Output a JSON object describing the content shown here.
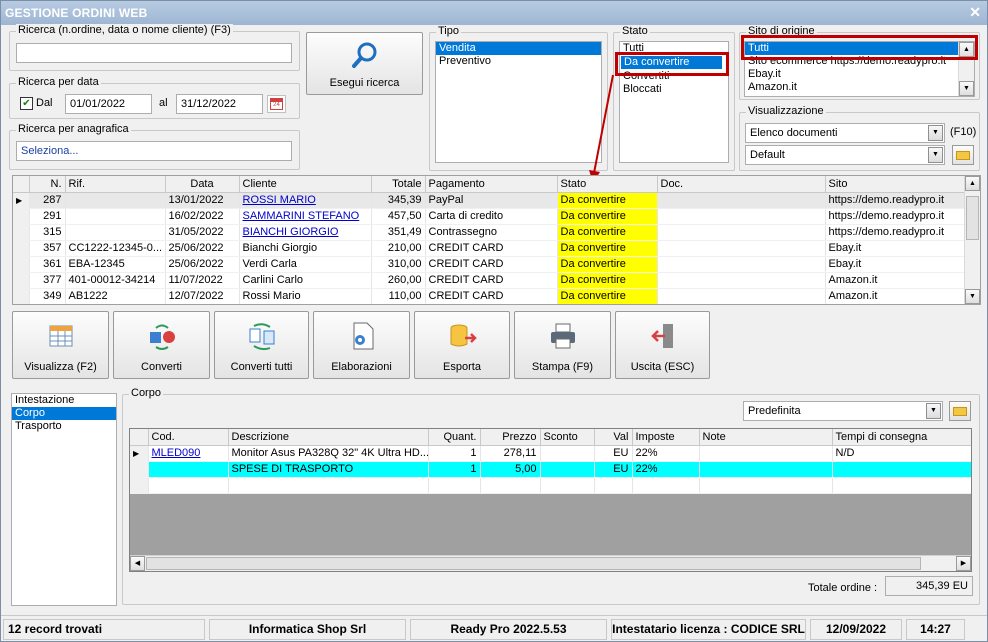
{
  "window": {
    "title": "GESTIONE ORDINI WEB",
    "close_icon": "close-icon"
  },
  "search": {
    "legend": "Ricerca (n.ordine, data o nome cliente) (F3)",
    "value": "",
    "button_label": "Esegui ricerca"
  },
  "date_search": {
    "legend": "Ricerca per data",
    "checkbox_label": "Dal",
    "checked": true,
    "from": "01/01/2022",
    "to_label": "al",
    "to": "31/12/2022"
  },
  "anagrafica": {
    "legend": "Ricerca per anagrafica",
    "value": "Seleziona..."
  },
  "tipo": {
    "legend": "Tipo",
    "items": [
      "Vendita",
      "Preventivo"
    ],
    "selected": "Vendita"
  },
  "stato": {
    "legend": "Stato",
    "items": [
      "Tutti",
      "Da convertire",
      "Convertiti",
      "Bloccati"
    ],
    "selected": "Da convertire"
  },
  "sito": {
    "legend": "Sito di origine",
    "items": [
      "Tutti",
      "Sito ecommerce https://demo.readypro.it",
      "Ebay.it",
      "Amazon.it"
    ],
    "selected": "Tutti"
  },
  "visualizzazione": {
    "legend": "Visualizzazione",
    "view_value": "Elenco documenti",
    "shortcut": "(F10)",
    "layout_value": "Default"
  },
  "orders": {
    "columns": [
      "N.",
      "Rif.",
      "Data",
      "Cliente",
      "Totale",
      "Pagamento",
      "Stato",
      "Doc.",
      "Sito"
    ],
    "rows": [
      {
        "n": "287",
        "rif": "",
        "data": "13/01/2022",
        "cliente": "ROSSI MARIO",
        "totale": "345,39",
        "pagamento": "PayPal",
        "stato": "Da convertire",
        "doc": "",
        "sito": "https://demo.readypro.it"
      },
      {
        "n": "291",
        "rif": "",
        "data": "16/02/2022",
        "cliente": "SAMMARINI STEFANO",
        "totale": "457,50",
        "pagamento": "Carta di credito",
        "stato": "Da convertire",
        "doc": "",
        "sito": "https://demo.readypro.it"
      },
      {
        "n": "315",
        "rif": "",
        "data": "31/05/2022",
        "cliente": "BIANCHI GIORGIO",
        "totale": "351,49",
        "pagamento": "Contrassegno",
        "stato": "Da convertire",
        "doc": "",
        "sito": "https://demo.readypro.it"
      },
      {
        "n": "357",
        "rif": "CC1222-12345-0...",
        "data": "25/06/2022",
        "cliente": "Bianchi Giorgio",
        "totale": "210,00",
        "pagamento": "CREDIT CARD",
        "stato": "Da convertire",
        "doc": "",
        "sito": "Ebay.it"
      },
      {
        "n": "361",
        "rif": "EBA-12345",
        "data": "25/06/2022",
        "cliente": "Verdi Carla",
        "totale": "310,00",
        "pagamento": "CREDIT CARD",
        "stato": "Da convertire",
        "doc": "",
        "sito": "Ebay.it"
      },
      {
        "n": "377",
        "rif": "401-00012-34214",
        "data": "11/07/2022",
        "cliente": "Carlini Carlo",
        "totale": "260,00",
        "pagamento": "CREDIT CARD",
        "stato": "Da convertire",
        "doc": "",
        "sito": "Amazon.it"
      },
      {
        "n": "349",
        "rif": "AB1222",
        "data": "12/07/2022",
        "cliente": "Rossi Mario",
        "totale": "110,00",
        "pagamento": "CREDIT CARD",
        "stato": "Da convertire",
        "doc": "",
        "sito": "Amazon.it"
      }
    ]
  },
  "toolbar": [
    {
      "label": "Visualizza (F2)",
      "icon": "grid-view-icon"
    },
    {
      "label": "Converti",
      "icon": "convert-icon"
    },
    {
      "label": "Converti tutti",
      "icon": "convert-all-icon"
    },
    {
      "label": "Elaborazioni",
      "icon": "gear-document-icon"
    },
    {
      "label": "Esporta",
      "icon": "export-database-icon"
    },
    {
      "label": "Stampa (F9)",
      "icon": "printer-icon"
    },
    {
      "label": "Uscita (ESC)",
      "icon": "exit-door-icon"
    }
  ],
  "sections": {
    "items": [
      "Intestazione",
      "Corpo",
      "Trasporto"
    ],
    "selected": "Corpo"
  },
  "corpo": {
    "legend": "Corpo",
    "layout_value": "Predefinita",
    "columns": [
      "Cod.",
      "Descrizione",
      "Quant.",
      "Prezzo",
      "Sconto",
      "Val",
      "Imposte",
      "Note",
      "Tempi di consegna"
    ],
    "rows": [
      {
        "cod": "MLED090",
        "descrizione": "Monitor Asus PA328Q 32\" 4K Ultra HD...",
        "quant": "1",
        "prezzo": "278,11",
        "sconto": "",
        "val": "EU",
        "imposte": "22%",
        "note": "",
        "tempi": "N/D"
      },
      {
        "cod": "",
        "descrizione": "SPESE DI TRASPORTO",
        "quant": "1",
        "prezzo": "5,00",
        "sconto": "",
        "val": "EU",
        "imposte": "22%",
        "note": "",
        "tempi": ""
      }
    ],
    "total_label": "Totale ordine :",
    "total_value": "345,39 EU"
  },
  "statusbar": {
    "records": "12 record trovati",
    "company": "Informatica Shop Srl",
    "version": "Ready Pro 2022.5.53",
    "license": "Intestatario licenza : CODICE SRL",
    "date": "12/09/2022",
    "time": "14:27"
  },
  "colors": {
    "accent": "#0078d7",
    "highlight_red": "#c00000",
    "status_yellow": "#ffff00",
    "row_cyan": "#00ffff"
  }
}
